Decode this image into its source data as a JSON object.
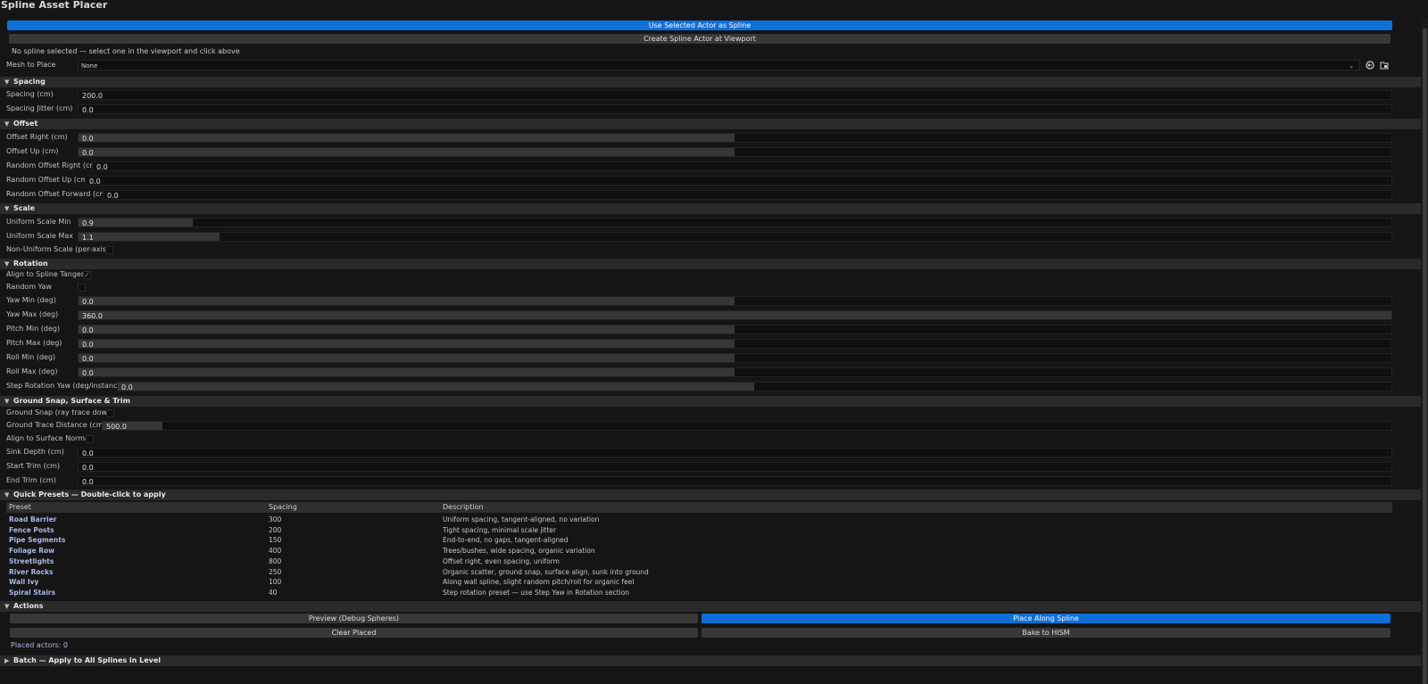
{
  "window_title": "Spline Asset Placer",
  "top_buttons": {
    "use_selected": "Use Selected Actor as Spline",
    "create_spline": "Create Spline Actor at Viewport"
  },
  "hint": "No spline selected — select one in the viewport and click above",
  "mesh": {
    "label": "Mesh to Place",
    "value": "None",
    "icons": [
      "browse-to-asset-icon",
      "open-content-browser-icon"
    ]
  },
  "spacing": {
    "header": "Spacing",
    "spacing_label": "Spacing (cm)",
    "spacing_value": "200.0",
    "jitter_label": "Spacing Jitter (cm)",
    "jitter_value": "0.0"
  },
  "offset": {
    "header": "Offset",
    "right_label": "Offset Right (cm)",
    "right_value": "0.0",
    "up_label": "Offset Up (cm)",
    "up_value": "0.0",
    "rand_right_label": "Random Offset Right (cm)",
    "rand_right_value": "0.0",
    "rand_up_label": "Random Offset Up (cm)",
    "rand_up_value": "0.0",
    "rand_fwd_label": "Random Offset Forward (cm)",
    "rand_fwd_value": "0.0"
  },
  "scale": {
    "header": "Scale",
    "min_label": "Uniform Scale Min",
    "min_value": "0.9",
    "max_label": "Uniform Scale Max",
    "max_value": "1.1",
    "nonuniform_label": "Non-Uniform Scale (per-axis)",
    "nonuniform_checked": false
  },
  "rotation": {
    "header": "Rotation",
    "align_label": "Align to Spline Tangent",
    "align_checked": true,
    "random_yaw_label": "Random Yaw",
    "random_yaw_checked": false,
    "yaw_min_label": "Yaw Min (deg)",
    "yaw_min_value": "0.0",
    "yaw_max_label": "Yaw Max (deg)",
    "yaw_max_value": "360.0",
    "pitch_min_label": "Pitch Min (deg)",
    "pitch_min_value": "0.0",
    "pitch_max_label": "Pitch Max (deg)",
    "pitch_max_value": "0.0",
    "roll_min_label": "Roll Min (deg)",
    "roll_min_value": "0.0",
    "roll_max_label": "Roll Max (deg)",
    "roll_max_value": "0.0",
    "step_yaw_label": "Step Rotation Yaw (deg/instance)",
    "step_yaw_value": "0.0"
  },
  "ground": {
    "header": "Ground Snap, Surface & Trim",
    "snap_label": "Ground Snap (ray trace down)",
    "snap_checked": false,
    "trace_label": "Ground Trace Distance (cm)",
    "trace_value": "500.0",
    "align_surface_label": "Align to Surface Normal",
    "align_surface_checked": false,
    "sink_label": "Sink Depth (cm)",
    "sink_value": "0.0",
    "start_trim_label": "Start Trim (cm)",
    "start_trim_value": "0.0",
    "end_trim_label": "End Trim (cm)",
    "end_trim_value": "0.0"
  },
  "presets": {
    "header": "Quick Presets — Double-click to apply",
    "columns": [
      "Preset",
      "Spacing",
      "Description"
    ],
    "rows": [
      {
        "name": "Road Barrier",
        "spacing": "300",
        "description": "Uniform spacing, tangent-aligned, no variation"
      },
      {
        "name": "Fence Posts",
        "spacing": "200",
        "description": "Tight spacing, minimal scale jitter"
      },
      {
        "name": "Pipe Segments",
        "spacing": "150",
        "description": "End-to-end, no gaps, tangent-aligned"
      },
      {
        "name": "Foliage Row",
        "spacing": "400",
        "description": "Trees/bushes, wide spacing, organic variation"
      },
      {
        "name": "Streetlights",
        "spacing": "800",
        "description": "Offset right, even spacing, uniform"
      },
      {
        "name": "River Rocks",
        "spacing": "250",
        "description": "Organic scatter, ground snap, surface align, sunk into ground"
      },
      {
        "name": "Wall Ivy",
        "spacing": "100",
        "description": "Along wall spline, slight random pitch/roll for organic feel"
      },
      {
        "name": "Spiral Stairs",
        "spacing": "40",
        "description": "Step rotation preset — use Step Yaw in Rotation section"
      }
    ]
  },
  "actions": {
    "header": "Actions",
    "preview": "Preview (Debug Spheres)",
    "place": "Place Along Spline",
    "clear": "Clear Placed",
    "bake": "Bake to HISM",
    "placed_count": "Placed actors: 0"
  },
  "batch": {
    "header": "Batch — Apply to All Splines in Level"
  },
  "colors": {
    "accent": "#0e6fd8",
    "link": "#a8b8e8",
    "background": "#151515",
    "section": "#2a2a2a"
  }
}
